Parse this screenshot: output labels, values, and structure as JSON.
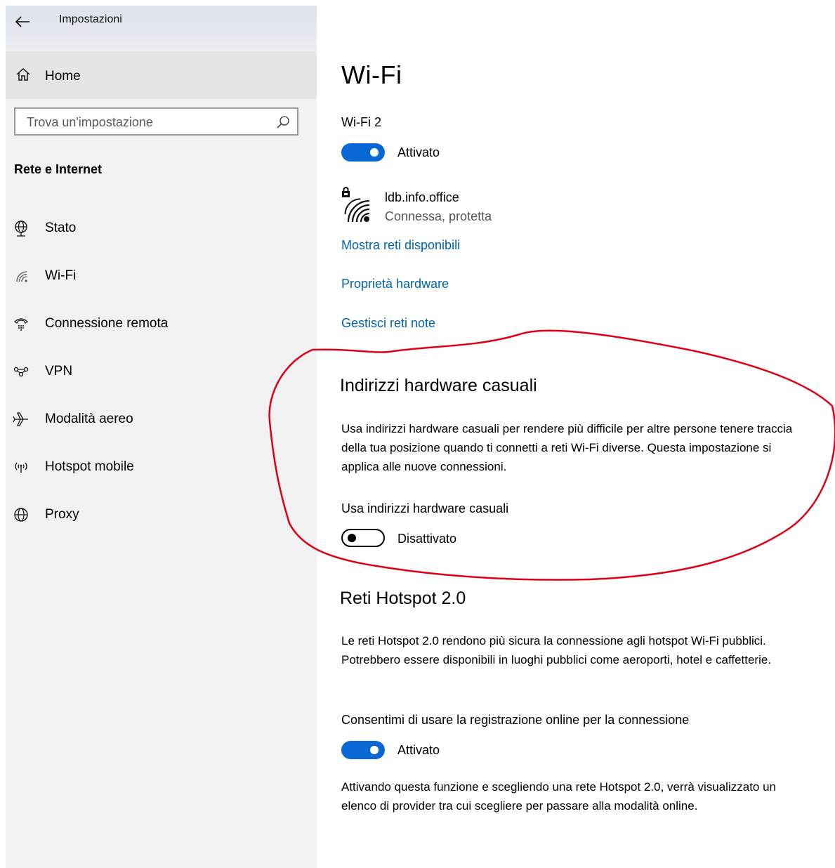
{
  "window": {
    "title": "Impostazioni"
  },
  "sidebar": {
    "home_label": "Home",
    "search_placeholder": "Trova un'impostazione",
    "section_title": "Rete e Internet",
    "items": [
      {
        "label": "Stato",
        "icon": "globe-network-icon"
      },
      {
        "label": "Wi-Fi",
        "icon": "wifi-icon"
      },
      {
        "label": "Connessione remota",
        "icon": "dialup-icon"
      },
      {
        "label": "VPN",
        "icon": "vpn-icon"
      },
      {
        "label": "Modalità aereo",
        "icon": "airplane-icon"
      },
      {
        "label": "Hotspot mobile",
        "icon": "hotspot-icon"
      },
      {
        "label": "Proxy",
        "icon": "globe-icon"
      }
    ]
  },
  "main": {
    "title": "Wi-Fi",
    "adapter_label": "Wi-Fi 2",
    "adapter_toggle": {
      "state": "on",
      "label": "Attivato"
    },
    "network": {
      "name": "ldb.info.office",
      "status": "Connessa, protetta",
      "icon": "secured-wifi-icon"
    },
    "links": [
      "Mostra reti disponibili",
      "Proprietà hardware",
      "Gestisci reti note"
    ],
    "random_hw": {
      "heading": "Indirizzi hardware casuali",
      "description": "Usa indirizzi hardware casuali per rendere più difficile per altre persone tenere traccia della tua posizione quando ti connetti a reti Wi-Fi diverse. Questa impostazione si applica alle nuove connessioni.",
      "toggle_label": "Usa indirizzi hardware casuali",
      "toggle": {
        "state": "off",
        "label": "Disattivato"
      }
    },
    "hotspot2": {
      "heading": "Reti Hotspot 2.0",
      "description": "Le reti Hotspot 2.0 rendono più sicura la connessione agli hotspot Wi-Fi pubblici. Potrebbero essere disponibili in luoghi pubblici come aeroporti, hotel e caffetterie.",
      "toggle_label": "Consentimi di usare la registrazione online per la connessione",
      "toggle": {
        "state": "on",
        "label": "Attivato"
      },
      "footer": "Attivando questa funzione e scegliendo una rete Hotspot 2.0, verrà visualizzato un elenco di provider tra cui scegliere per passare alla modalità online."
    }
  },
  "colors": {
    "accent": "#0a68d4",
    "link": "#0063b1",
    "annotation": "#e00016",
    "sidebar_bg": "#f2f2f2"
  }
}
